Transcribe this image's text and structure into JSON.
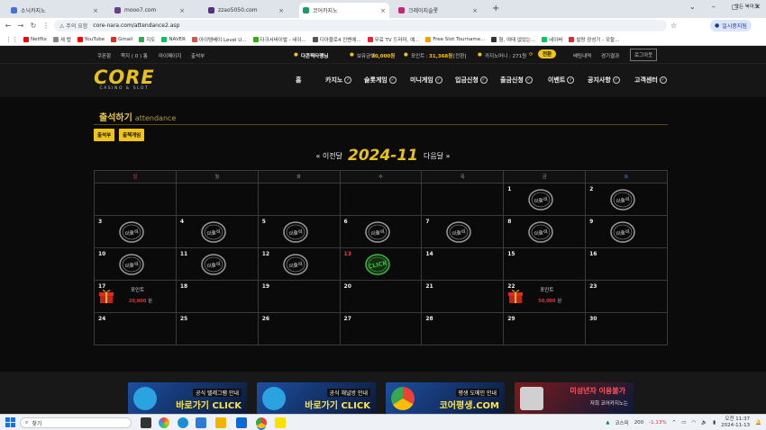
{
  "browser": {
    "tabs": [
      {
        "title": "소닉카지노",
        "color": "#4a6fd8"
      },
      {
        "title": "mooo7.com",
        "color": "#6b3d8a"
      },
      {
        "title": "zzao5050.com",
        "color": "#5a2e88"
      },
      {
        "title": "코어카지노",
        "color": "#1a9a6a"
      },
      {
        "title": "크레이지슬롯",
        "color": "#c2287a"
      }
    ],
    "add_tab": "+",
    "window_controls": [
      "⌄",
      "–",
      "▢",
      "✕"
    ],
    "security_label": "주의 요함",
    "url": "core-nara.com/attendance2.asp",
    "profile": "일시중지됨",
    "bookmarks": [
      {
        "label": "Netflix",
        "color": "#e50914"
      },
      {
        "label": "새 탭",
        "color": "#888"
      },
      {
        "label": "YouTube",
        "color": "#ff0000"
      },
      {
        "label": "Gmail",
        "color": "#d93025"
      },
      {
        "label": "지도",
        "color": "#34a853"
      },
      {
        "label": "NAVER",
        "color": "#03c75a"
      },
      {
        "label": "아이템베이 Level U...",
        "color": "#d9534f"
      },
      {
        "label": "다크서바이벌 - 네이...",
        "color": "#2db400"
      },
      {
        "label": "디아블로4 인벤에...",
        "color": "#555"
      },
      {
        "label": "무료 TV 드라마, 예...",
        "color": "#e23"
      },
      {
        "label": "Free Slot Tourname...",
        "color": "#f4a000"
      },
      {
        "label": "형, 여태 없었는...",
        "color": "#333"
      },
      {
        "label": "네이버",
        "color": "#03c75a"
      },
      {
        "label": "발랑 광성기 - 모할...",
        "color": "#c33"
      }
    ],
    "all_bookmarks": "모든 북마크"
  },
  "topbar": {
    "links": [
      "쿠폰함",
      "쪽지 ( 0 ) 통",
      "마이페이지",
      "출석부"
    ],
    "nickname": "다콘찍타랭님",
    "balance_label": "보유금액 :",
    "balance": "20,000원",
    "point_label": "포인트 :",
    "point": "31,368원",
    "point_convert": "[전환]",
    "casino_money_label": "카지노머니 : 271원",
    "exchange_btn": "전환",
    "history": "배팅내역",
    "results": "경기결과",
    "logout": "로그아웃"
  },
  "logo": {
    "main": "CORE",
    "sub": "CASINO & SLOT"
  },
  "nav": [
    "홈",
    "카지노",
    "슬롯게임",
    "미니게임",
    "입금신청",
    "출금신청",
    "이벤트",
    "공지사항",
    "고객센터"
  ],
  "page": {
    "title": "출석하기",
    "title_en": "attendance",
    "btn_attendance": "출석부",
    "btn_rules": "출첵게임",
    "prev": "« 이전달",
    "month": "2024-11",
    "next": "다음달 »"
  },
  "calendar": {
    "weekdays": [
      "일",
      "월",
      "화",
      "수",
      "목",
      "금",
      "토"
    ],
    "weekday_colors": [
      "#e84040",
      "#999",
      "#999",
      "#999",
      "#999",
      "#999",
      "#4a7de8"
    ],
    "weeks": [
      [
        "",
        "",
        "",
        "",
        "",
        "1",
        "2"
      ],
      [
        "3",
        "4",
        "5",
        "6",
        "7",
        "8",
        "9"
      ],
      [
        "10",
        "11",
        "12",
        "13",
        "14",
        "15",
        "16"
      ],
      [
        "17",
        "18",
        "19",
        "20",
        "21",
        "22",
        "23"
      ],
      [
        "24",
        "25",
        "26",
        "27",
        "28",
        "29",
        "30"
      ]
    ],
    "missed_label": "미출석",
    "check_label": "CLICK",
    "missed_days": [
      "1",
      "2",
      "3",
      "4",
      "5",
      "6",
      "7",
      "8",
      "9",
      "10",
      "11",
      "12"
    ],
    "today": "13",
    "today_color": "#e84040",
    "rewards": [
      {
        "day": "17",
        "label": "포인트",
        "amount": "20,000",
        "unit": "원"
      },
      {
        "day": "22",
        "label": "포인트",
        "amount": "50,000",
        "unit": "원"
      }
    ]
  },
  "banners": [
    {
      "line1": "공식 텔레그램 안내",
      "line2": "바로가기 CLICK",
      "bg": "#1d4fa0"
    },
    {
      "line1": "공식 채널방 안내",
      "line2": "바로가기 CLICK",
      "bg": "#1d4fa0"
    },
    {
      "line1": "평생 도메인 안내",
      "line2": "코어평생.COM",
      "bg": "#1d4fa0"
    },
    {
      "line1": "미성년자 이용불가",
      "line2": "저희 코어카지노는",
      "bg": "#7a1a1a"
    }
  ],
  "taskbar": {
    "search": "찾기",
    "stock_name": "코스피",
    "stock_value": "200",
    "stock_change": "-1.13%",
    "time": "오전 11:37",
    "date": "2024-11-13"
  }
}
